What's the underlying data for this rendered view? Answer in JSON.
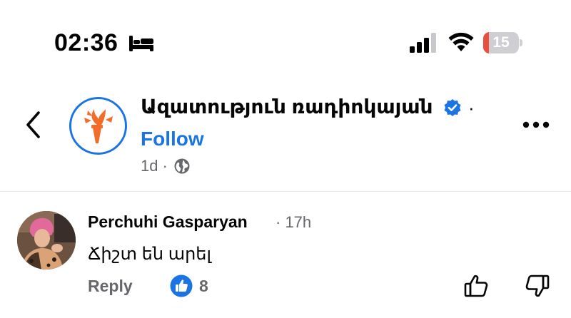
{
  "status_bar": {
    "time": "02:36",
    "sleep_icon": "bed-icon",
    "signal_icon": "cellular-signal-icon",
    "wifi_icon": "wifi-icon",
    "battery_level": "15",
    "battery_fraction": 0.15,
    "battery_color": "#eb4e3d"
  },
  "post": {
    "back_icon": "chevron-left-icon",
    "page_name": "Ազատություն ռադիոկայան",
    "verified_icon": "verified-badge-icon",
    "name_separator": "·",
    "follow_label": "Follow",
    "age": "1d",
    "meta_separator": "·",
    "audience_icon": "globe-icon",
    "more_icon": "more-horizontal-icon",
    "brand_color": "#1b74e4",
    "logo_color": "#f26c2a"
  },
  "comment": {
    "author": "Perchuhi Gasparyan",
    "time": "· 17h",
    "text": "Ճիշտ են արել",
    "reply_label": "Reply",
    "like_count": "8",
    "like_badge_icon": "like-badge-icon",
    "like_icon": "thumb-up-icon",
    "dislike_icon": "thumb-down-icon"
  }
}
